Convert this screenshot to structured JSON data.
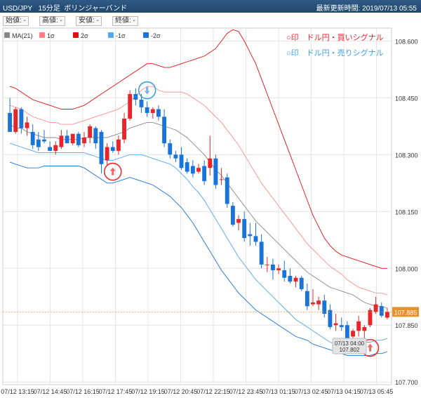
{
  "header": {
    "symbol": "USD/JPY",
    "timeframe": "15分足",
    "indicator": "ボリンジャーバンド",
    "updated": "最新更新時間: 2019/07/13 05:55"
  },
  "ohlc_bar": {
    "open": "始値: -",
    "high": "高値: -",
    "low": "安値: -",
    "close": "終値: -"
  },
  "signals_legend": {
    "buy": "○印　ドル円・買いシグナル",
    "sell": "○印　ドル円・売りシグナル"
  },
  "colors": {
    "up": "#e8252a",
    "down": "#1a73d9",
    "ma": "#888888",
    "sigma1_up": "#ff8080",
    "sigma2_up": "#e01010",
    "sigma1_dn": "#53a7ef",
    "sigma2_dn": "#1a73d9",
    "current_price_bg": "#e8902a"
  },
  "chart_data": {
    "type": "candlestick",
    "y_ticks": [
      "108.600",
      "108.450",
      "108.300",
      "108.150",
      "108.000",
      "107.850",
      "107.700"
    ],
    "ylim": [
      107.693,
      108.634
    ],
    "x_labels": [
      "07/12 13:15",
      "07/12 14:45",
      "07/12 16:15",
      "07/12 17:45",
      "07/12 19:15",
      "07/12 20:45",
      "07/12 22:15",
      "07/12 23:45",
      "07/13 01:15",
      "07/13 02:45",
      "07/13 04:15",
      "07/13 05:45"
    ],
    "series_legend": [
      "MA(21)",
      "1σ",
      "2σ",
      "-1σ",
      "-2σ"
    ],
    "current_price": "107.885",
    "cursor_label": {
      "time": "07/13 04:00",
      "price": "107.802"
    },
    "candles": [
      {
        "o": 108.41,
        "h": 108.45,
        "l": 108.36,
        "c": 108.36
      },
      {
        "o": 108.36,
        "h": 108.425,
        "l": 108.355,
        "c": 108.42
      },
      {
        "o": 108.42,
        "h": 108.425,
        "l": 108.355,
        "c": 108.37
      },
      {
        "o": 108.37,
        "h": 108.4,
        "l": 108.35,
        "c": 108.385
      },
      {
        "o": 108.36,
        "h": 108.38,
        "l": 108.315,
        "c": 108.325
      },
      {
        "o": 108.34,
        "h": 108.36,
        "l": 108.31,
        "c": 108.32
      },
      {
        "o": 108.34,
        "h": 108.365,
        "l": 108.33,
        "c": 108.335
      },
      {
        "o": 108.32,
        "h": 108.335,
        "l": 108.31,
        "c": 108.31
      },
      {
        "o": 108.31,
        "h": 108.335,
        "l": 108.3,
        "c": 108.325
      },
      {
        "o": 108.32,
        "h": 108.365,
        "l": 108.315,
        "c": 108.35
      },
      {
        "o": 108.35,
        "h": 108.365,
        "l": 108.33,
        "c": 108.33
      },
      {
        "o": 108.33,
        "h": 108.355,
        "l": 108.325,
        "c": 108.355
      },
      {
        "o": 108.355,
        "h": 108.36,
        "l": 108.32,
        "c": 108.325
      },
      {
        "o": 108.33,
        "h": 108.36,
        "l": 108.32,
        "c": 108.345
      },
      {
        "o": 108.345,
        "h": 108.38,
        "l": 108.33,
        "c": 108.375
      },
      {
        "o": 108.37,
        "h": 108.375,
        "l": 108.315,
        "c": 108.33
      },
      {
        "o": 108.36,
        "h": 108.365,
        "l": 108.25,
        "c": 108.275
      },
      {
        "o": 108.285,
        "h": 108.33,
        "l": 108.27,
        "c": 108.32
      },
      {
        "o": 108.32,
        "h": 108.335,
        "l": 108.305,
        "c": 108.31
      },
      {
        "o": 108.31,
        "h": 108.35,
        "l": 108.3,
        "c": 108.34
      },
      {
        "o": 108.34,
        "h": 108.41,
        "l": 108.33,
        "c": 108.395
      },
      {
        "o": 108.395,
        "h": 108.47,
        "l": 108.39,
        "c": 108.46
      },
      {
        "o": 108.46,
        "h": 108.475,
        "l": 108.43,
        "c": 108.445
      },
      {
        "o": 108.445,
        "h": 108.46,
        "l": 108.41,
        "c": 108.425
      },
      {
        "o": 108.425,
        "h": 108.44,
        "l": 108.4,
        "c": 108.41
      },
      {
        "o": 108.41,
        "h": 108.425,
        "l": 108.395,
        "c": 108.42
      },
      {
        "o": 108.42,
        "h": 108.43,
        "l": 108.39,
        "c": 108.4
      },
      {
        "o": 108.4,
        "h": 108.42,
        "l": 108.32,
        "c": 108.33
      },
      {
        "o": 108.33,
        "h": 108.34,
        "l": 108.29,
        "c": 108.3
      },
      {
        "o": 108.3,
        "h": 108.31,
        "l": 108.28,
        "c": 108.29
      },
      {
        "o": 108.3,
        "h": 108.32,
        "l": 108.26,
        "c": 108.265
      },
      {
        "o": 108.28,
        "h": 108.29,
        "l": 108.25,
        "c": 108.255
      },
      {
        "o": 108.27,
        "h": 108.285,
        "l": 108.24,
        "c": 108.25
      },
      {
        "o": 108.255,
        "h": 108.275,
        "l": 108.25,
        "c": 108.265
      },
      {
        "o": 108.27,
        "h": 108.285,
        "l": 108.22,
        "c": 108.23
      },
      {
        "o": 108.265,
        "h": 108.35,
        "l": 108.245,
        "c": 108.29
      },
      {
        "o": 108.29,
        "h": 108.3,
        "l": 108.21,
        "c": 108.22
      },
      {
        "o": 108.235,
        "h": 108.265,
        "l": 108.22,
        "c": 108.235
      },
      {
        "o": 108.24,
        "h": 108.25,
        "l": 108.16,
        "c": 108.17
      },
      {
        "o": 108.165,
        "h": 108.175,
        "l": 108.11,
        "c": 108.115
      },
      {
        "o": 108.12,
        "h": 108.14,
        "l": 108.1,
        "c": 108.13
      },
      {
        "o": 108.13,
        "h": 108.15,
        "l": 108.07,
        "c": 108.08
      },
      {
        "o": 108.09,
        "h": 108.12,
        "l": 108.06,
        "c": 108.085
      },
      {
        "o": 108.085,
        "h": 108.12,
        "l": 108.06,
        "c": 108.07
      },
      {
        "o": 108.07,
        "h": 108.09,
        "l": 108.0,
        "c": 108.01
      },
      {
        "o": 108.01,
        "h": 108.03,
        "l": 107.99,
        "c": 108.01
      },
      {
        "o": 108.01,
        "h": 108.025,
        "l": 107.97,
        "c": 107.995
      },
      {
        "o": 107.995,
        "h": 108.01,
        "l": 107.985,
        "c": 108.0
      },
      {
        "o": 107.995,
        "h": 108.02,
        "l": 107.965,
        "c": 107.975
      },
      {
        "o": 107.98,
        "h": 108.0,
        "l": 107.96,
        "c": 107.965
      },
      {
        "o": 107.965,
        "h": 107.98,
        "l": 107.95,
        "c": 107.975
      },
      {
        "o": 107.975,
        "h": 107.98,
        "l": 107.94,
        "c": 107.945
      },
      {
        "o": 107.94,
        "h": 107.96,
        "l": 107.89,
        "c": 107.9
      },
      {
        "o": 107.905,
        "h": 107.945,
        "l": 107.9,
        "c": 107.91
      },
      {
        "o": 107.905,
        "h": 107.925,
        "l": 107.89,
        "c": 107.915
      },
      {
        "o": 107.915,
        "h": 107.93,
        "l": 107.87,
        "c": 107.88
      },
      {
        "o": 107.89,
        "h": 107.905,
        "l": 107.84,
        "c": 107.845
      },
      {
        "o": 107.85,
        "h": 107.88,
        "l": 107.835,
        "c": 107.855
      },
      {
        "o": 107.85,
        "h": 107.87,
        "l": 107.835,
        "c": 107.845
      },
      {
        "o": 107.85,
        "h": 107.86,
        "l": 107.79,
        "c": 107.795
      },
      {
        "o": 107.82,
        "h": 107.84,
        "l": 107.81,
        "c": 107.835
      },
      {
        "o": 107.835,
        "h": 107.875,
        "l": 107.82,
        "c": 107.86
      },
      {
        "o": 107.835,
        "h": 107.85,
        "l": 107.815,
        "c": 107.845
      },
      {
        "o": 107.85,
        "h": 107.895,
        "l": 107.845,
        "c": 107.89
      },
      {
        "o": 107.885,
        "h": 107.925,
        "l": 107.88,
        "c": 107.905
      },
      {
        "o": 107.9,
        "h": 107.91,
        "l": 107.87,
        "c": 107.875
      },
      {
        "o": 107.87,
        "h": 107.895,
        "l": 107.865,
        "c": 107.885
      }
    ],
    "ma21": [
      108.38,
      108.37,
      108.37,
      108.36,
      108.355,
      108.35,
      108.345,
      108.345,
      108.345,
      108.34,
      108.34,
      108.34,
      108.34,
      108.345,
      108.345,
      108.345,
      108.345,
      108.345,
      108.35,
      108.355,
      108.36,
      108.37,
      108.375,
      108.38,
      108.385,
      108.385,
      108.38,
      108.375,
      108.37,
      108.365,
      108.355,
      108.345,
      108.33,
      108.315,
      108.3,
      108.28,
      108.26,
      108.245,
      108.225,
      108.205,
      108.185,
      108.165,
      108.145,
      108.125,
      108.11,
      108.095,
      108.08,
      108.065,
      108.05,
      108.035,
      108.02,
      108.005,
      107.99,
      107.98,
      107.97,
      107.96,
      107.95,
      107.945,
      107.94,
      107.935,
      107.93,
      107.92,
      107.91,
      107.905,
      107.9,
      107.9,
      107.895
    ],
    "sigma1_up": [
      108.43,
      108.425,
      108.42,
      108.41,
      108.4,
      108.395,
      108.39,
      108.385,
      108.385,
      108.38,
      108.38,
      108.38,
      108.385,
      108.39,
      108.395,
      108.4,
      108.405,
      108.41,
      108.415,
      108.42,
      108.43,
      108.44,
      108.455,
      108.47,
      108.48,
      108.48,
      108.47,
      108.465,
      108.465,
      108.465,
      108.465,
      108.46,
      108.45,
      108.44,
      108.43,
      108.415,
      108.4,
      108.385,
      108.365,
      108.345,
      108.325,
      108.3,
      108.275,
      108.25,
      108.225,
      108.205,
      108.185,
      108.165,
      108.145,
      108.125,
      108.105,
      108.085,
      108.065,
      108.05,
      108.035,
      108.02,
      108.005,
      107.995,
      107.985,
      107.97,
      107.96,
      107.95,
      107.945,
      107.94,
      107.935,
      107.935,
      107.93
    ],
    "sigma2_up": [
      108.48,
      108.475,
      108.465,
      108.455,
      108.445,
      108.44,
      108.435,
      108.43,
      108.425,
      108.42,
      108.42,
      108.42,
      108.425,
      108.43,
      108.44,
      108.45,
      108.46,
      108.47,
      108.48,
      108.49,
      108.5,
      108.51,
      108.52,
      108.53,
      108.54,
      108.54,
      108.535,
      108.53,
      108.53,
      108.535,
      108.54,
      108.545,
      108.55,
      108.555,
      108.56,
      108.57,
      108.58,
      108.6,
      108.62,
      108.63,
      108.625,
      108.6,
      108.57,
      108.54,
      108.5,
      108.46,
      108.42,
      108.38,
      108.34,
      108.3,
      108.26,
      108.22,
      108.18,
      108.14,
      108.11,
      108.08,
      108.06,
      108.045,
      108.035,
      108.03,
      108.025,
      108.02,
      108.015,
      108.01,
      108.005,
      108.0,
      108.0
    ],
    "sigma1_dn": [
      108.33,
      108.325,
      108.32,
      108.315,
      108.31,
      108.305,
      108.305,
      108.305,
      108.305,
      108.305,
      108.305,
      108.305,
      108.305,
      108.305,
      108.3,
      108.295,
      108.29,
      108.285,
      108.285,
      108.29,
      108.295,
      108.3,
      108.3,
      108.3,
      108.295,
      108.29,
      108.285,
      108.28,
      108.275,
      108.265,
      108.25,
      108.235,
      108.215,
      108.2,
      108.18,
      108.155,
      108.13,
      108.105,
      108.08,
      108.055,
      108.03,
      108.01,
      107.99,
      107.97,
      107.955,
      107.94,
      107.925,
      107.91,
      107.895,
      107.88,
      107.865,
      107.855,
      107.845,
      107.835,
      107.825,
      107.815,
      107.805,
      107.8,
      107.8,
      107.8,
      107.8,
      107.8,
      107.805,
      107.805,
      107.81,
      107.81,
      107.815
    ],
    "sigma2_dn": [
      108.28,
      108.275,
      108.27,
      108.265,
      108.265,
      108.265,
      108.27,
      108.27,
      108.27,
      108.27,
      108.27,
      108.27,
      108.27,
      108.265,
      108.255,
      108.245,
      108.235,
      108.225,
      108.225,
      108.23,
      108.235,
      108.24,
      108.235,
      108.23,
      108.225,
      108.22,
      108.21,
      108.2,
      108.19,
      108.175,
      108.16,
      108.14,
      108.12,
      108.095,
      108.07,
      108.045,
      108.02,
      107.995,
      107.975,
      107.955,
      107.935,
      107.92,
      107.905,
      107.89,
      107.88,
      107.87,
      107.86,
      107.85,
      107.84,
      107.83,
      107.82,
      107.815,
      107.81,
      107.8,
      107.795,
      107.79,
      107.785,
      107.78,
      107.775,
      107.77,
      107.77,
      107.77,
      107.77,
      107.77,
      107.775,
      107.775,
      107.78
    ]
  }
}
